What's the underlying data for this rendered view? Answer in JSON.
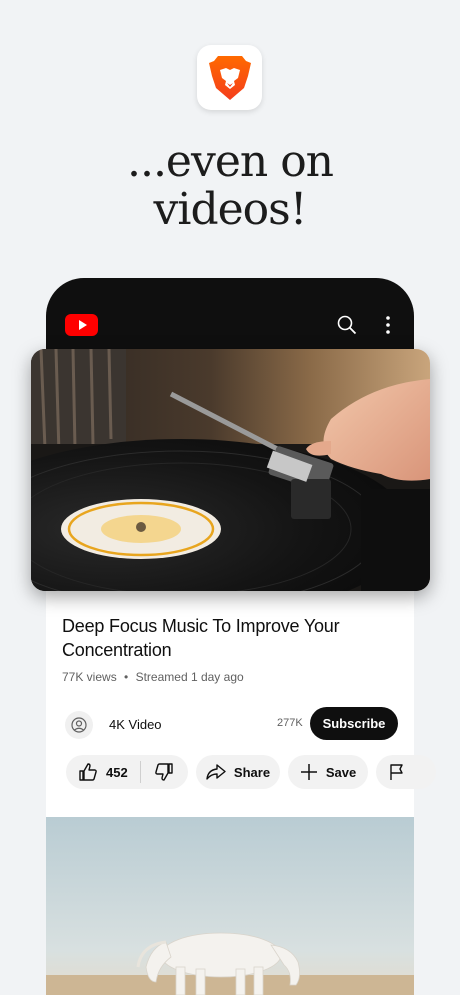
{
  "headline": {
    "line1": "...even on",
    "line2": "videos!"
  },
  "video": {
    "title": "Deep Focus Music To Improve Your Concentration",
    "views": "77K views",
    "separator": "•",
    "age": "Streamed 1 day ago"
  },
  "channel": {
    "name": "4K Video",
    "subscribers": "277K",
    "subscribe_label": "Subscribe"
  },
  "actions": {
    "likes": "452",
    "share_label": "Share",
    "save_label": "Save"
  },
  "colors": {
    "youtube_red": "#ff0000",
    "brave_orange": "#fb542b",
    "topbar": "#0f0f0f"
  },
  "icons": [
    "brave-lion-icon",
    "youtube-logo-icon",
    "search-icon",
    "more-vertical-icon",
    "user-icon",
    "thumbs-up-icon",
    "thumbs-down-icon",
    "share-icon",
    "plus-icon",
    "flag-icon"
  ]
}
